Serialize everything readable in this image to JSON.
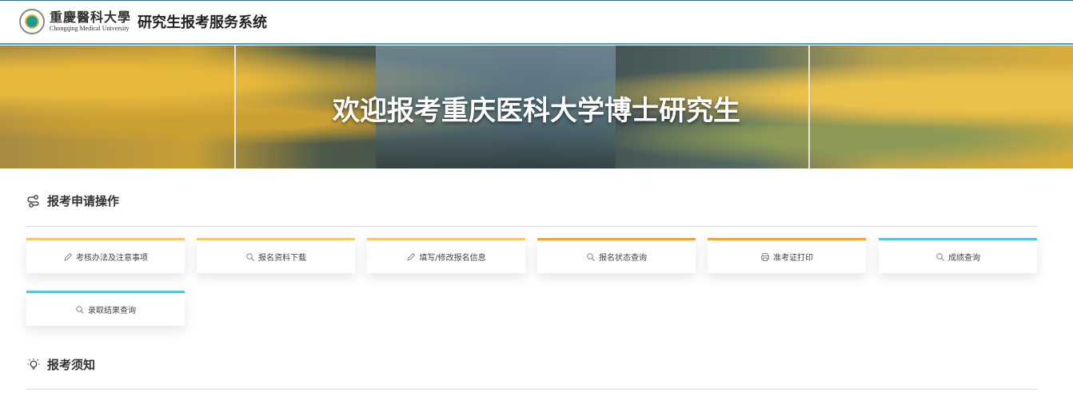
{
  "header": {
    "university_cn": "重慶醫科大學",
    "university_en": "Chongqing Medical University",
    "system_title": "研究生报考服务系统"
  },
  "banner": {
    "title": "欢迎报考重庆医科大学博士研究生"
  },
  "sections": {
    "apply": {
      "title": "报考申请操作",
      "icon": "flow-icon",
      "cards": [
        {
          "label": "考核办法及注意事项",
          "icon": "pencil-icon",
          "accent": "#f5c86e"
        },
        {
          "label": "报名资料下载",
          "icon": "search-icon",
          "accent": "#f5c86e"
        },
        {
          "label": "填写/修改报名信息",
          "icon": "pencil-icon",
          "accent": "#f5c86e"
        },
        {
          "label": "报名状态查询",
          "icon": "search-icon",
          "accent": "#f0a53a"
        },
        {
          "label": "准考证打印",
          "icon": "printer-icon",
          "accent": "#f0a53a"
        },
        {
          "label": "成绩查询",
          "icon": "search-icon",
          "accent": "#5bc3d8"
        },
        {
          "label": "录取结果查询",
          "icon": "search-icon",
          "accent": "#5bc3d8"
        }
      ]
    },
    "notice": {
      "title": "报考须知",
      "icon": "lightbulb-icon"
    }
  }
}
